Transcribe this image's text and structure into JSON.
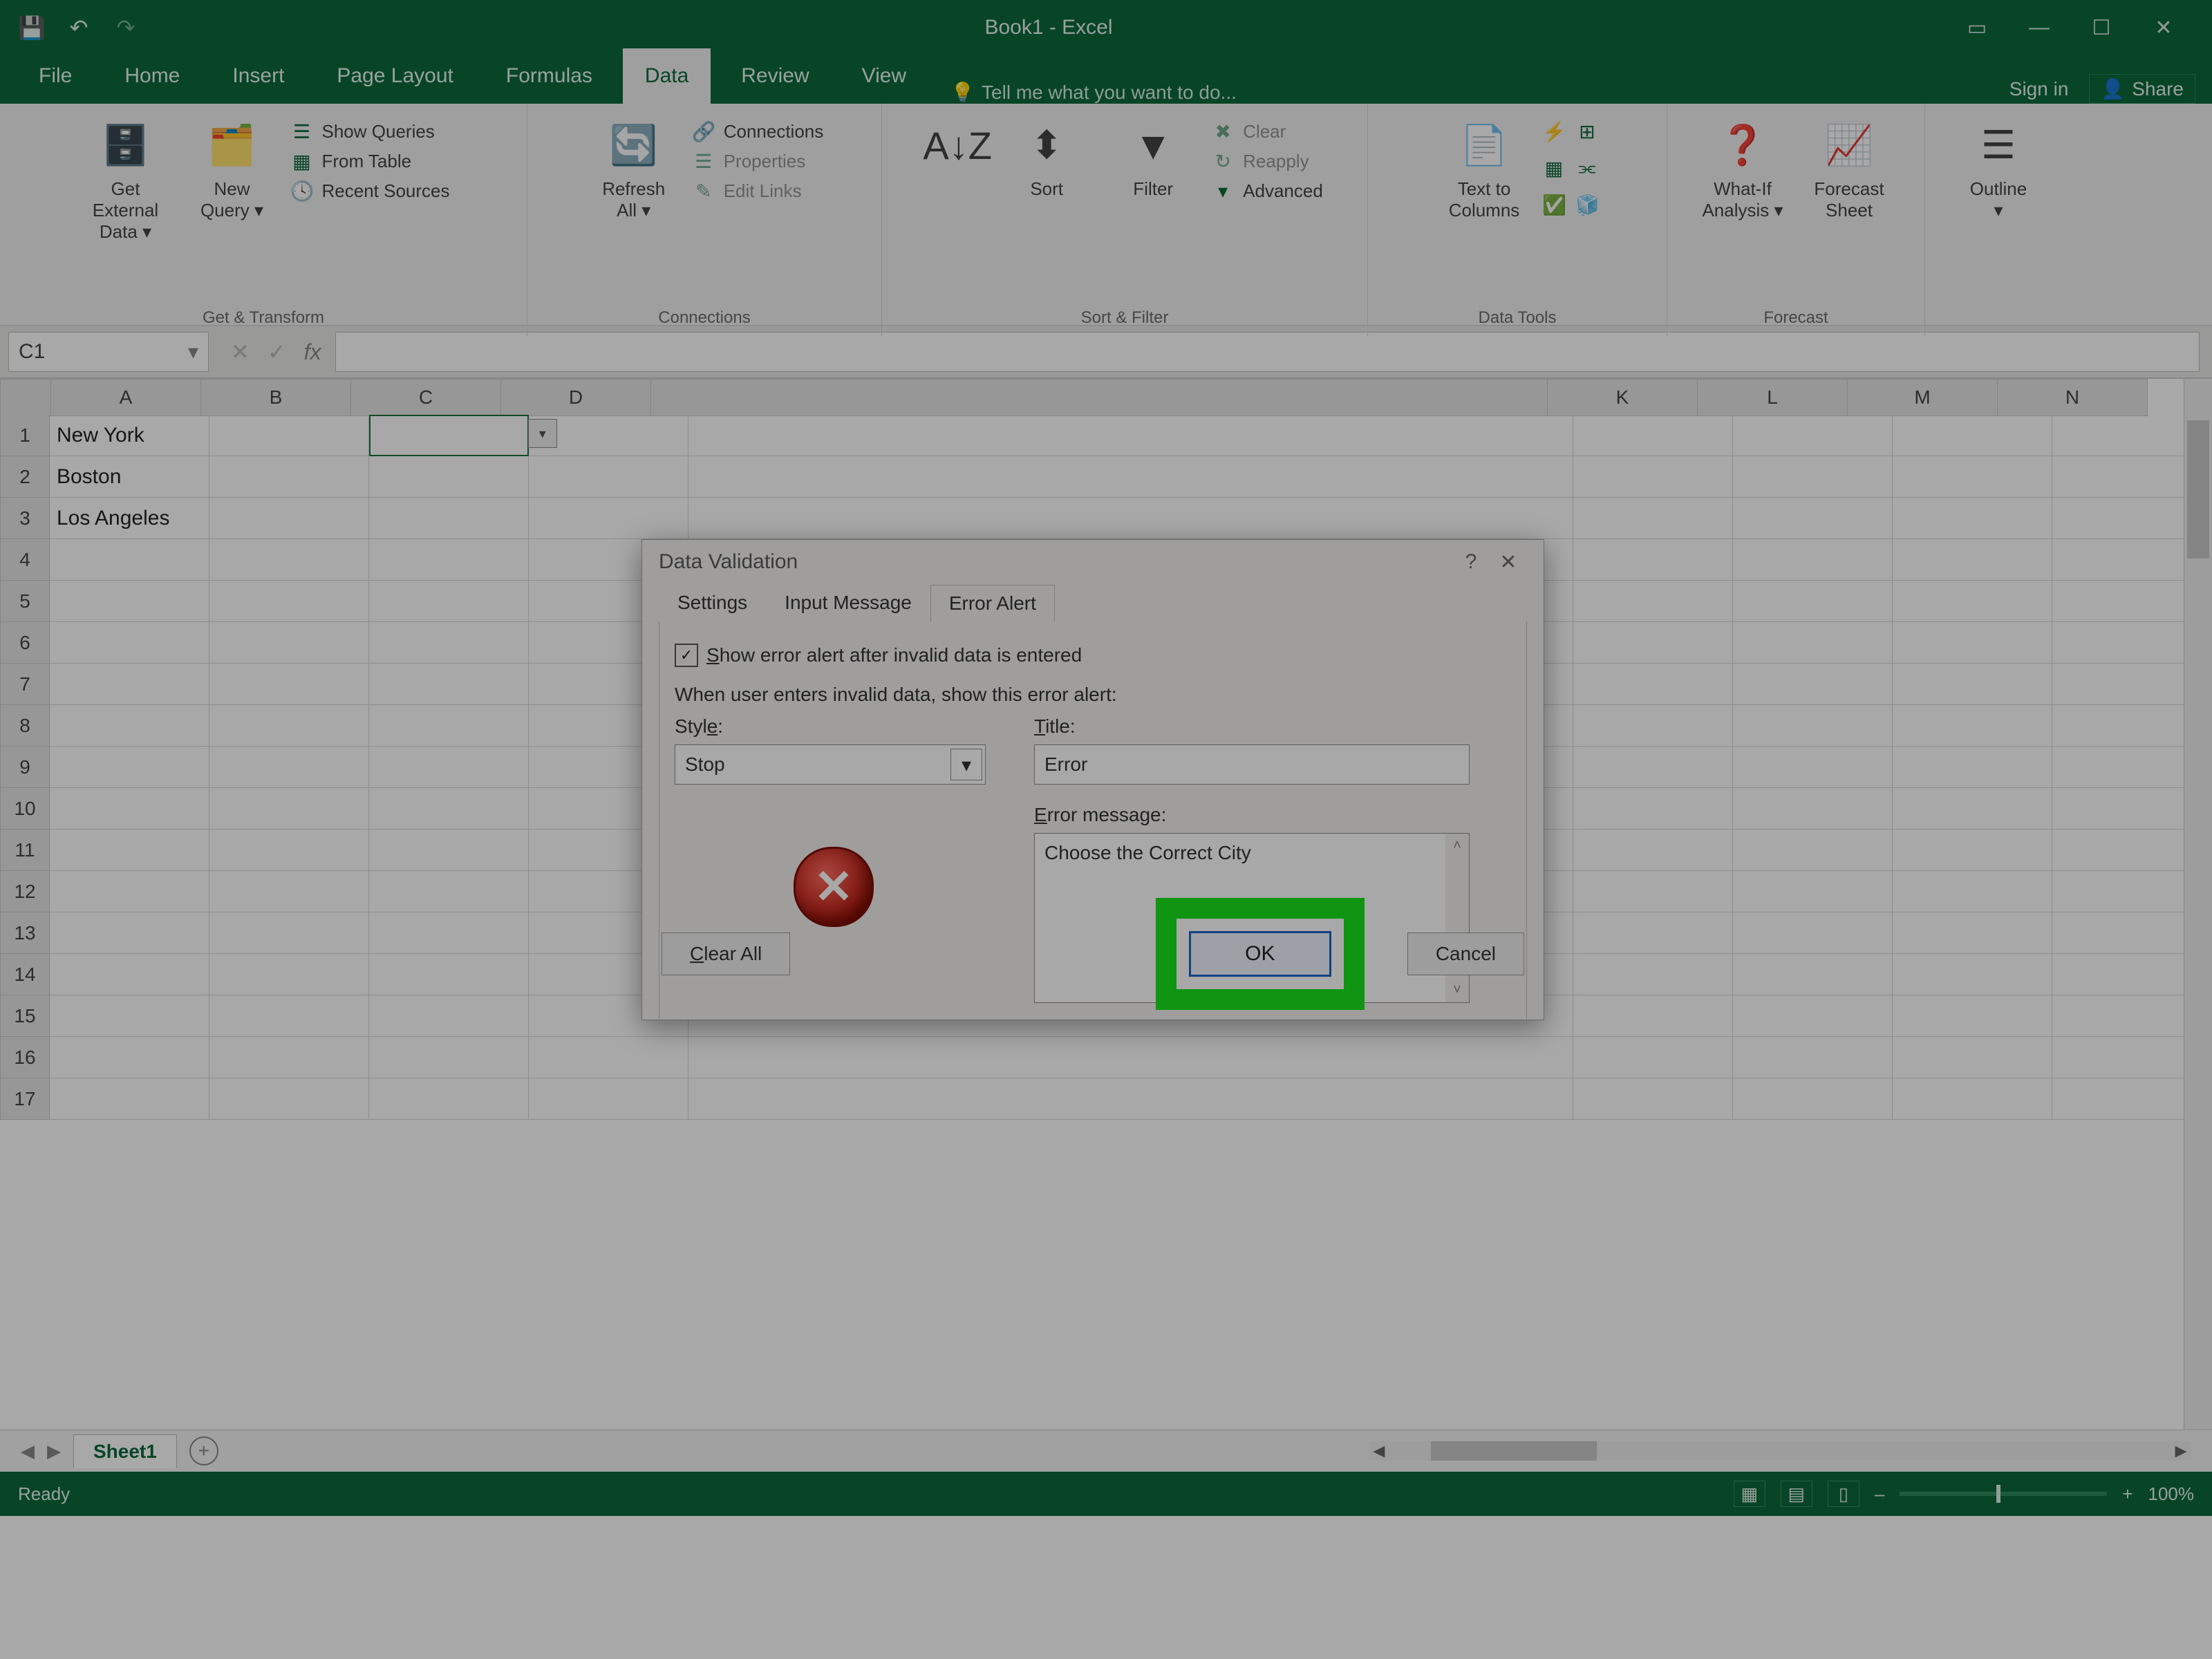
{
  "app": {
    "title": "Book1 - Excel"
  },
  "window_controls": {
    "ribbon_opts_icon": "▭",
    "min_icon": "—",
    "max_icon": "☐",
    "close_icon": "✕"
  },
  "qat": {
    "save_icon": "💾",
    "undo_icon": "↶",
    "redo_icon": "↷"
  },
  "menu": {
    "items": [
      "File",
      "Home",
      "Insert",
      "Page Layout",
      "Formulas",
      "Data",
      "Review",
      "View"
    ],
    "active": "Data",
    "tellme": "Tell me what you want to do...",
    "signin": "Sign in",
    "share": "Share"
  },
  "ribbon": {
    "groups": {
      "get_transform": {
        "label": "Get & Transform",
        "get_external": "Get External\nData ▾",
        "new_query": "New\nQuery ▾",
        "show_queries": "Show Queries",
        "from_table": "From Table",
        "recent_sources": "Recent Sources"
      },
      "connections": {
        "label": "Connections",
        "refresh": "Refresh\nAll ▾",
        "connections": "Connections",
        "properties": "Properties",
        "edit_links": "Edit Links"
      },
      "sort_filter": {
        "label": "Sort & Filter",
        "sort": "Sort",
        "filter": "Filter",
        "clear": "Clear",
        "reapply": "Reapply",
        "advanced": "Advanced"
      },
      "data_tools": {
        "label": "Data Tools",
        "text_cols": "Text to\nColumns"
      },
      "forecast": {
        "label": "Forecast",
        "whatif": "What-If\nAnalysis ▾",
        "forecast_sheet": "Forecast\nSheet"
      },
      "outline": {
        "label": "",
        "outline": "Outline\n▾"
      }
    }
  },
  "namebox": {
    "value": "C1",
    "dropdown": "▾"
  },
  "fx": {
    "cancel": "✕",
    "enter": "✓",
    "fx": "fx"
  },
  "columns": [
    "A",
    "B",
    "C",
    "D",
    "K",
    "L",
    "M",
    "N"
  ],
  "rows_visible": 17,
  "cells": {
    "A1": "New York",
    "A2": "Boston",
    "A3": "Los Angeles"
  },
  "sheettabs": {
    "active": "Sheet1",
    "add_icon": "+"
  },
  "statusbar": {
    "ready": "Ready",
    "zoom": "100%",
    "minus": "–",
    "plus": "+"
  },
  "dialog": {
    "title": "Data Validation",
    "help_icon": "?",
    "close_icon": "✕",
    "tabs": [
      "Settings",
      "Input Message",
      "Error Alert"
    ],
    "active_tab": "Error Alert",
    "checkbox_label_pre": "S",
    "checkbox_label": "how error alert after invalid data is entered",
    "checkbox_checked": "✓",
    "prompt": "When user enters invalid data, show this error alert:",
    "style_label_pre": "Styl",
    "style_label_ul": "e",
    "style_label_post": ":",
    "style_value": "Stop",
    "title_label_ul": "T",
    "title_label": "itle:",
    "title_value": "Error",
    "errmsg_label_ul": "E",
    "errmsg_label": "rror message:",
    "errmsg_value": "Choose the Correct City",
    "clear_all_ul": "C",
    "clear_all": "lear All",
    "ok": "OK",
    "cancel": "Cancel"
  }
}
